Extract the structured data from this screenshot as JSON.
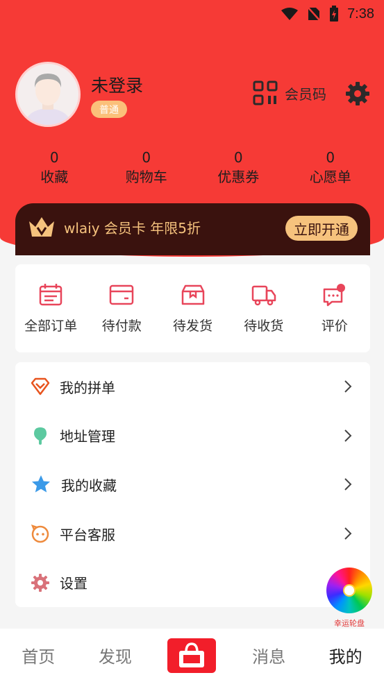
{
  "status_bar": {
    "time": "7:38"
  },
  "profile": {
    "username": "未登录",
    "level": "普通",
    "member_code_label": "会员码"
  },
  "stats": [
    {
      "value": "0",
      "label": "收藏"
    },
    {
      "value": "0",
      "label": "购物车"
    },
    {
      "value": "0",
      "label": "优惠券"
    },
    {
      "value": "0",
      "label": "心愿单"
    }
  ],
  "vip": {
    "text": "wlaiy 会员卡 年限5折",
    "button": "立即开通"
  },
  "orders": [
    {
      "label": "全部订单",
      "icon": "order-list-icon"
    },
    {
      "label": "待付款",
      "icon": "wallet-icon"
    },
    {
      "label": "待发货",
      "icon": "box-icon"
    },
    {
      "label": "待收货",
      "icon": "truck-icon"
    },
    {
      "label": "评价",
      "icon": "comment-icon"
    }
  ],
  "menu": [
    {
      "label": "我的拼单",
      "icon": "diamond-icon"
    },
    {
      "label": "地址管理",
      "icon": "location-pin-icon"
    },
    {
      "label": "我的收藏",
      "icon": "star-icon"
    },
    {
      "label": "平台客服",
      "icon": "customer-service-icon"
    },
    {
      "label": "设置",
      "icon": "gear-icon"
    }
  ],
  "lucky_wheel": {
    "label": "幸运轮盘"
  },
  "tabbar": {
    "home": "首页",
    "discover": "发现",
    "messages": "消息",
    "mine": "我的"
  },
  "colors": {
    "header_red": "#f63a36",
    "gold": "#f5c27d",
    "vip_dark": "#3a120e",
    "order_icon": "#e8455a"
  }
}
